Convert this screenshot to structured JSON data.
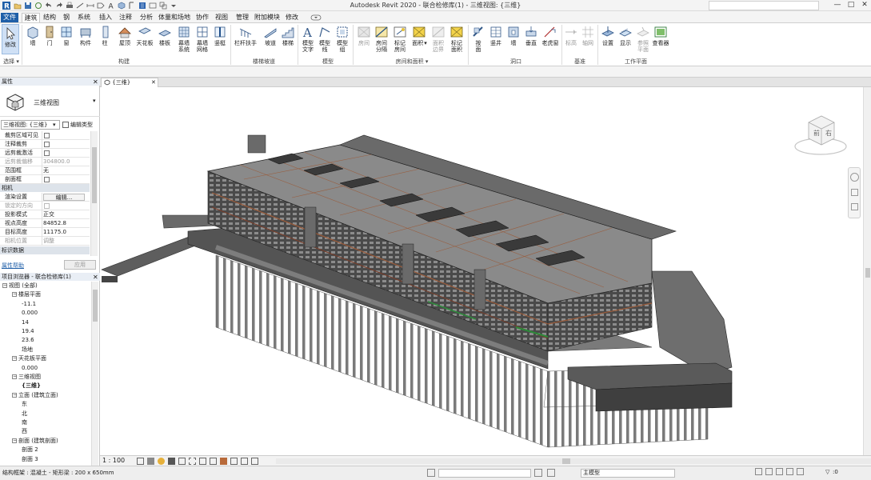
{
  "title_bar": {
    "title": "Autodesk Revit 2020 - 联合检修库(1) - 三维视图: {三维}",
    "window_buttons": [
      "—",
      "□",
      "✕"
    ]
  },
  "ribbon_tabs": [
    "文件",
    "建筑",
    "结构",
    "钢",
    "系统",
    "插入",
    "注释",
    "分析",
    "体量和场地",
    "协作",
    "视图",
    "管理",
    "附加模块",
    "修改"
  ],
  "ribbon": {
    "select_panel": {
      "modify": "修改",
      "select": "选择"
    },
    "build": {
      "buttons": [
        "墙",
        "门",
        "窗",
        "构件",
        "柱",
        "屋顶",
        "天花板",
        "楼板",
        "幕墙\n系统",
        "幕墙\n网格",
        "竖梃"
      ],
      "group": "构建"
    },
    "circulation": {
      "buttons": [
        "栏杆扶手",
        "坡道",
        "楼梯"
      ],
      "group": "楼梯坡道"
    },
    "model": {
      "buttons": [
        "模型\n文字",
        "模型\n线",
        "模型\n组"
      ],
      "group": "模型"
    },
    "room_area": {
      "buttons": [
        "房间",
        "房间\n分隔",
        "标记\n房间",
        "面积",
        "面积\n边界",
        "标记\n面积"
      ],
      "group": "房间和面积"
    },
    "opening": {
      "buttons": [
        "按\n面",
        "竖井",
        "墙",
        "垂直",
        "老虎窗"
      ],
      "group": "洞口"
    },
    "datum": {
      "buttons": [
        "标高",
        "轴网"
      ],
      "group": "基准"
    },
    "workplane": {
      "buttons": [
        "设置",
        "显示",
        "参照\n平面",
        "查看器"
      ],
      "group": "工作平面"
    }
  },
  "properties": {
    "header": "属性",
    "type_name": "三维视图",
    "selector": "三维视图: {三维}",
    "edit_type": "编辑类型",
    "rows": [
      {
        "label": "裁剪区域可见",
        "value": "",
        "checkbox": true,
        "disabled": false
      },
      {
        "label": "注释裁剪",
        "value": "",
        "checkbox": true,
        "disabled": false
      },
      {
        "label": "远剪裁激活",
        "value": "",
        "checkbox": true,
        "disabled": false
      },
      {
        "label": "远剪裁偏移",
        "value": "304800.0",
        "checkbox": false,
        "disabled": true
      },
      {
        "label": "范围框",
        "value": "无",
        "checkbox": false,
        "disabled": false
      },
      {
        "label": "剖面框",
        "value": "",
        "checkbox": true,
        "disabled": false
      }
    ],
    "camera_category": "相机",
    "camera_rows": [
      {
        "label": "渲染设置",
        "value": "编辑...",
        "button": true,
        "disabled": false
      },
      {
        "label": "锁定的方向",
        "value": "",
        "checkbox": true,
        "disabled": true
      },
      {
        "label": "投影模式",
        "value": "正交",
        "disabled": false
      },
      {
        "label": "视点高度",
        "value": "84852.8",
        "disabled": false
      },
      {
        "label": "目标高度",
        "value": "11175.0",
        "disabled": false
      },
      {
        "label": "相机位置",
        "value": "调整",
        "disabled": true
      }
    ],
    "identity_category": "标识数据",
    "help_link": "属性帮助",
    "apply": "应用"
  },
  "project_browser": {
    "header": "项目浏览器 - 联合检修库(1)",
    "nodes": [
      {
        "text": "视图 (全部)",
        "level": 0,
        "box": "−"
      },
      {
        "text": "楼层平面",
        "level": 1,
        "box": "−"
      },
      {
        "text": "-11.1",
        "level": 2
      },
      {
        "text": "0.000",
        "level": 2
      },
      {
        "text": "14",
        "level": 2
      },
      {
        "text": "19.4",
        "level": 2
      },
      {
        "text": "23.6",
        "level": 2
      },
      {
        "text": "场地",
        "level": 2
      },
      {
        "text": "天花板平面",
        "level": 1,
        "box": "−"
      },
      {
        "text": "0.000",
        "level": 2
      },
      {
        "text": "三维视图",
        "level": 1,
        "box": "−"
      },
      {
        "text": "{三维}",
        "level": 2,
        "bold": true
      },
      {
        "text": "立面 (建筑立面)",
        "level": 1,
        "box": "−"
      },
      {
        "text": "东",
        "level": 2
      },
      {
        "text": "北",
        "level": 2
      },
      {
        "text": "南",
        "level": 2
      },
      {
        "text": "西",
        "level": 2
      },
      {
        "text": "剖面 (建筑剖面)",
        "level": 1,
        "box": "−"
      },
      {
        "text": "剖面 2",
        "level": 2
      },
      {
        "text": "剖面 3",
        "level": 2
      }
    ]
  },
  "view_tab": {
    "label": "{三维}"
  },
  "viewcube": {
    "front": "前",
    "right": "右"
  },
  "view_control": {
    "scale": "1 : 100"
  },
  "status_bar": {
    "text": "结构框架 : 混凝土 - 矩形梁 : 200 x 650mm",
    "workset": "主模型",
    "filter_count": ":0"
  },
  "colors": {
    "file_tab": "#1f5fa8",
    "model_gray": "#6e6e6e",
    "roof_gray": "#8a8a8a",
    "accent_brown": "#9a5b3a"
  }
}
